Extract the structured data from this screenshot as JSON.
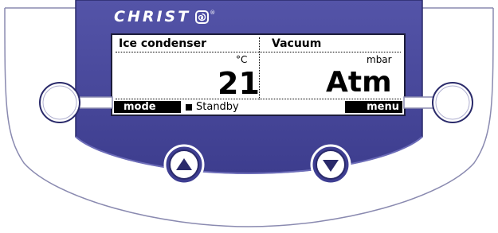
{
  "brand": {
    "name": "CHRIST",
    "logo_icon": "christ-logo-icon"
  },
  "display": {
    "left_panel": {
      "title": "Ice condenser",
      "unit": "°C",
      "value": "21"
    },
    "right_panel": {
      "title": "Vacuum",
      "unit": "mbar",
      "value": "Atm"
    },
    "status": {
      "icon": "square-bullet-icon",
      "text": "Standby"
    },
    "softkeys": {
      "left": "mode",
      "right": "menu"
    }
  },
  "controls": {
    "left_round_button": "round-button-icon",
    "right_round_button": "round-button-icon",
    "up_button": "triangle-up-icon",
    "down_button": "triangle-down-icon"
  },
  "colors": {
    "panel_blue": "#4a4a9c",
    "panel_blue_dark": "#2f2f7a",
    "button_fill": "#3e3e92",
    "lcd_bg": "#ffffff",
    "lcd_text": "#000000",
    "outline": "#8888b8"
  }
}
